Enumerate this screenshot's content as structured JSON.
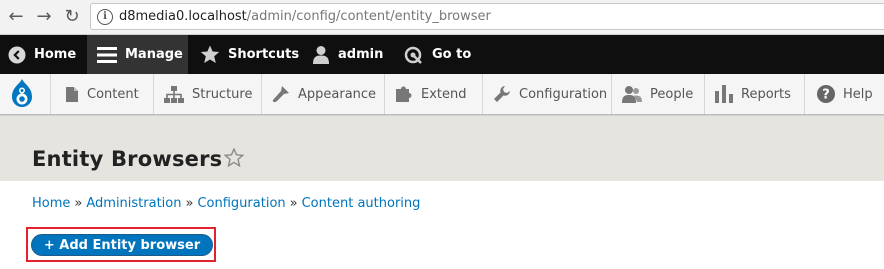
{
  "browser": {
    "url_host": "d8media0.localhost",
    "url_path": "/admin/config/content/entity_browser"
  },
  "toolbar": {
    "home": "Home",
    "manage": "Manage",
    "shortcuts": "Shortcuts",
    "user": "admin",
    "goto": "Go to"
  },
  "tray": {
    "items": [
      "Content",
      "Structure",
      "Appearance",
      "Extend",
      "Configuration",
      "People",
      "Reports",
      "Help"
    ]
  },
  "page": {
    "title": "Entity Browsers"
  },
  "breadcrumb": {
    "items": [
      "Home",
      "Administration",
      "Configuration",
      "Content authoring"
    ],
    "separator": "»"
  },
  "actions": {
    "add_label": "+ Add Entity browser"
  },
  "colors": {
    "toolbar_bg": "#0f0f0f",
    "link": "#0074bd",
    "highlight_frame": "#e0232e"
  }
}
